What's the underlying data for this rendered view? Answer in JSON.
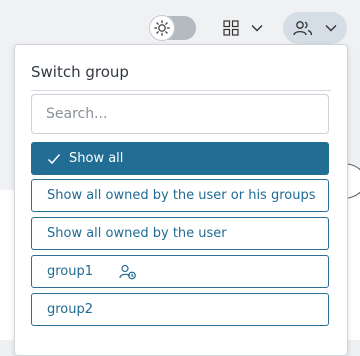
{
  "header": {
    "theme_icon": "sun-icon",
    "apps_icon": "grid-icon",
    "apps_chevron": "chevron-down-icon",
    "group_icon": "users-icon",
    "group_chevron": "chevron-down-icon"
  },
  "switcher": {
    "title": "Switch group",
    "search_placeholder": "Search...",
    "options": [
      {
        "label": "Show all",
        "selected": true,
        "icon": "check-icon"
      },
      {
        "label": "Show all owned by the user or his groups",
        "selected": false
      },
      {
        "label": "Show all owned by the user",
        "selected": false
      },
      {
        "label": "group1",
        "selected": false,
        "icon": "group-owner-icon"
      },
      {
        "label": "group2",
        "selected": false
      }
    ]
  },
  "colors": {
    "accent": "#226d94",
    "accent_text": "#1f6b93",
    "group_button_bg": "#d5dde6"
  }
}
